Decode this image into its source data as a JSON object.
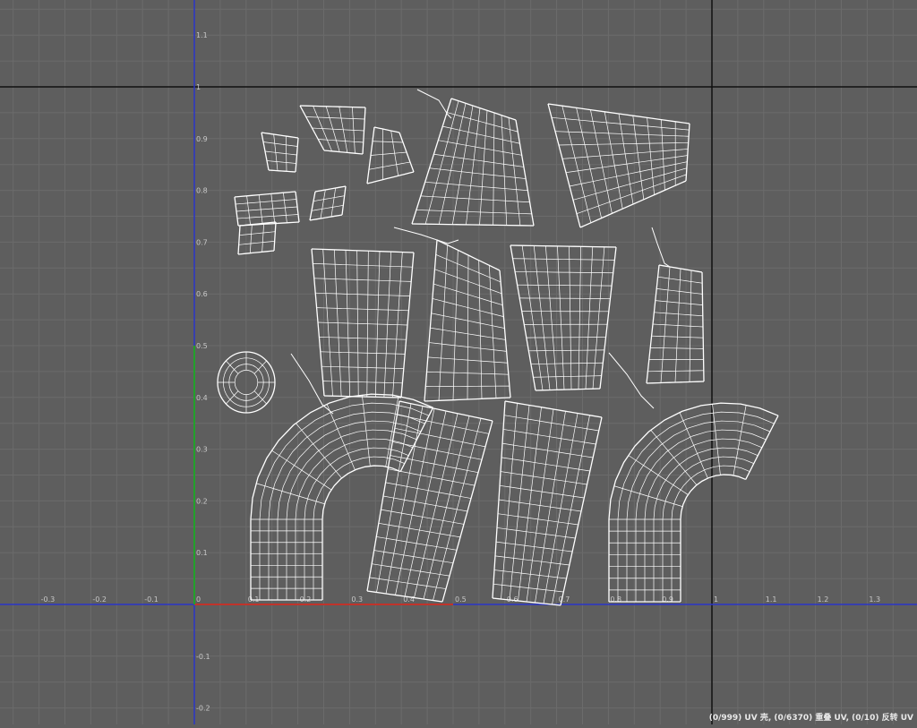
{
  "editor": {
    "x_tick_labels": [
      "-0.3",
      "-0.2",
      "-0.1",
      "0",
      "0.1",
      "0.2",
      "0.3",
      "0.4",
      "0.5",
      "0.6",
      "0.7",
      "0.8",
      "0.9",
      "1",
      "1.1",
      "1.2",
      "1.3"
    ],
    "y_tick_labels": [
      "1.1",
      "1",
      "0.9",
      "0.8",
      "0.7",
      "0.6",
      "0.5",
      "0.4",
      "0.3",
      "0.2",
      "0.1",
      "-0.1",
      "-0.2"
    ],
    "grid_step": 0.05,
    "colors": {
      "background": "#5e5e5e",
      "grid": "#6b6b6b",
      "boundary": "#111111",
      "u_axis": "#2a35c8",
      "v_axis": "#2a35c8",
      "u_highlight": "#c0332b",
      "v_highlight": "#21a12a",
      "wire": "#ffffff"
    }
  },
  "status": {
    "text": "(0/999) UV 壳, (0/6370) 重叠 UV, (0/10) 反转 UV"
  }
}
